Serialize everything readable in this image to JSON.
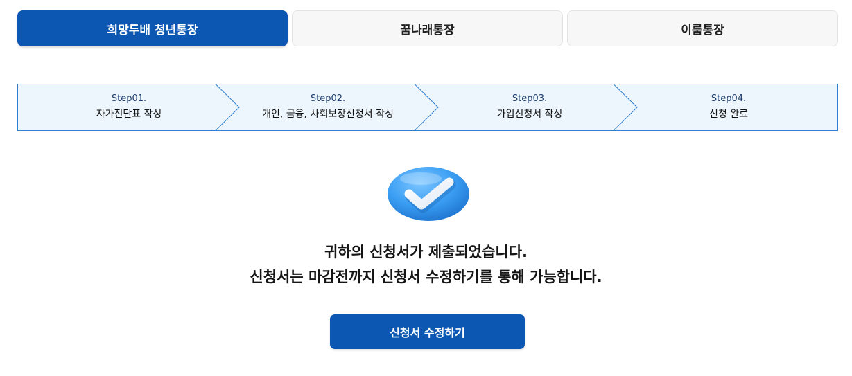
{
  "tabs": [
    {
      "label": "희망두배 청년통장",
      "active": true
    },
    {
      "label": "꿈나래통장",
      "active": false
    },
    {
      "label": "이룸통장",
      "active": false
    }
  ],
  "steps": [
    {
      "number": "Step01.",
      "title": "자가진단표 작성"
    },
    {
      "number": "Step02.",
      "title": "개인, 금융, 사회보장신청서 작성"
    },
    {
      "number": "Step03.",
      "title": "가입신청서 작성"
    },
    {
      "number": "Step04.",
      "title": "신청 완료"
    }
  ],
  "result": {
    "icon": "check-circle-icon",
    "line1": "귀하의 신청서가 제출되었습니다.",
    "line2": "신청서는 마감전까지 신청서 수정하기를 통해 가능합니다."
  },
  "actions": {
    "edit_label": "신청서 수정하기"
  },
  "colors": {
    "primary": "#0b57b2",
    "step_bg": "#eef6fd",
    "step_border": "#2d7fd0",
    "icon_blue": "#3a9ef3"
  }
}
